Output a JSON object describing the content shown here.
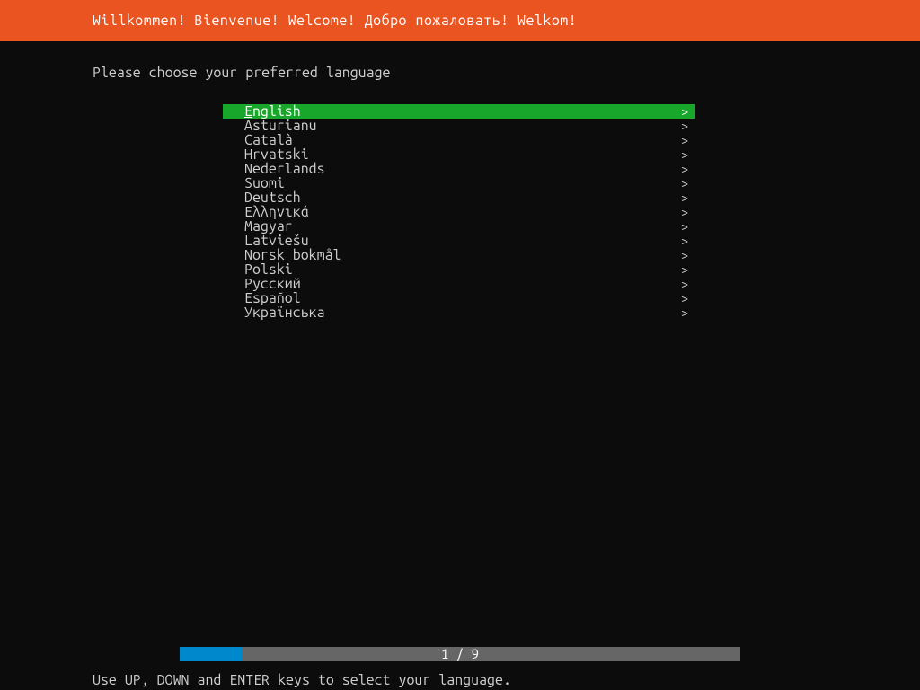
{
  "header": {
    "title": "Willkommen! Bienvenue! Welcome! Добро пожаловать! Welkom!"
  },
  "prompt": "Please choose your preferred language",
  "languages": [
    {
      "label": "English",
      "selected": true
    },
    {
      "label": "Asturianu",
      "selected": false
    },
    {
      "label": "Català",
      "selected": false
    },
    {
      "label": "Hrvatski",
      "selected": false
    },
    {
      "label": "Nederlands",
      "selected": false
    },
    {
      "label": "Suomi",
      "selected": false
    },
    {
      "label": "Deutsch",
      "selected": false
    },
    {
      "label": "Ελληνικά",
      "selected": false
    },
    {
      "label": "Magyar",
      "selected": false
    },
    {
      "label": "Latviešu",
      "selected": false
    },
    {
      "label": "Norsk bokmål",
      "selected": false
    },
    {
      "label": "Polski",
      "selected": false
    },
    {
      "label": "Русский",
      "selected": false
    },
    {
      "label": "Español",
      "selected": false
    },
    {
      "label": "Українська",
      "selected": false
    }
  ],
  "progress": {
    "current": 1,
    "total": 9,
    "text": "1 / 9"
  },
  "footer": {
    "hint": "Use UP, DOWN and ENTER keys to select your language."
  },
  "colors": {
    "header_bg": "#e95420",
    "selected_bg": "#19a72b",
    "progress_fill": "#0088cc",
    "progress_bg": "#666666",
    "text": "#d0d0d0",
    "bg": "#0c0c0c"
  }
}
